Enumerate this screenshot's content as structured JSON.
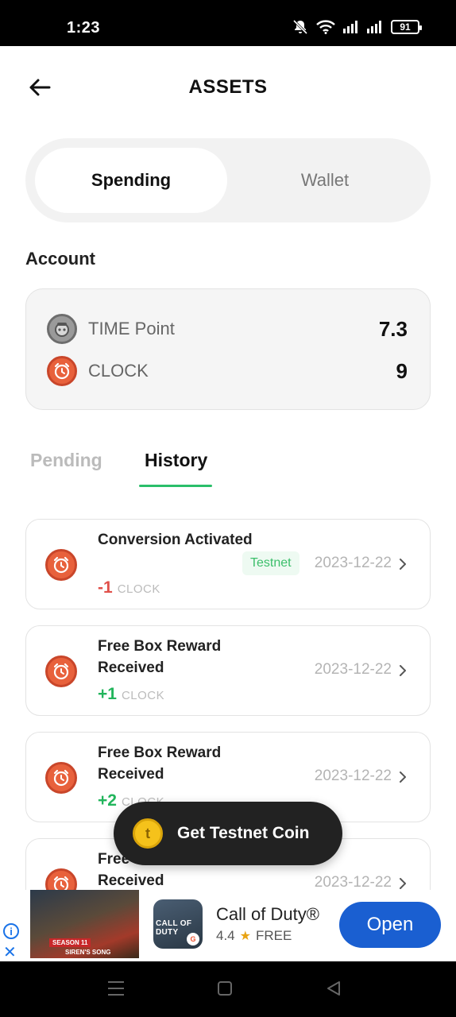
{
  "status_bar": {
    "time": "1:23",
    "battery": "91"
  },
  "header": {
    "title": "ASSETS"
  },
  "segments": {
    "active": "Spending",
    "inactive": "Wallet"
  },
  "account": {
    "section_label": "Account",
    "rows": [
      {
        "label": "TIME Point",
        "value": "7.3",
        "icon": "time-point-icon"
      },
      {
        "label": "CLOCK",
        "value": "9",
        "icon": "clock-icon"
      }
    ]
  },
  "tabs": {
    "pending": "Pending",
    "history": "History",
    "selected": "History"
  },
  "history": [
    {
      "title": "Conversion Activated",
      "amount": "-1",
      "unit": "CLOCK",
      "badge": "Testnet",
      "date": "2023-12-22"
    },
    {
      "title": "Free Box Reward Received",
      "amount": "+1",
      "unit": "CLOCK",
      "badge": "",
      "date": "2023-12-22"
    },
    {
      "title": "Free Box Reward Received",
      "amount": "+2",
      "unit": "CLOCK",
      "badge": "",
      "date": "2023-12-22"
    },
    {
      "title": "Free Box Reward Received",
      "amount": "",
      "unit": "",
      "badge": "",
      "date": "2023-12-22"
    }
  ],
  "fab": {
    "label": "Get Testnet Coin",
    "coin_letter": "t"
  },
  "ad": {
    "app_name": "Call of Duty®",
    "rating": "4.4",
    "price": "FREE",
    "cta": "Open",
    "image_text_1": "SEASON 11",
    "image_text_2": "SIREN'S SONG",
    "icon_text": "CALL OF DUTY",
    "info_glyph": "i",
    "close_glyph": "✕"
  },
  "colors": {
    "accent_green": "#2bbf6a",
    "clock_orange": "#e8613c",
    "negative_red": "#e0504a",
    "ad_blue": "#1a5fd1"
  }
}
